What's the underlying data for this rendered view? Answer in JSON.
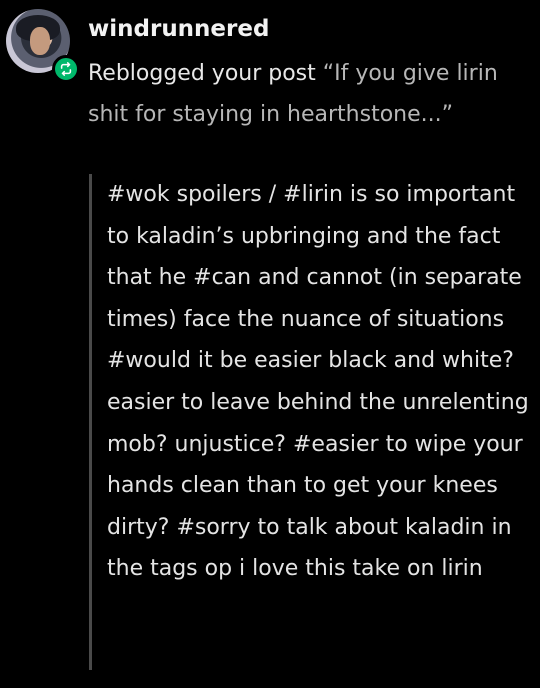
{
  "user": {
    "avatar_icon": "avatar",
    "badge_icon": "reblog-icon",
    "badge_color": "#00b86b",
    "username": "windrunnered"
  },
  "activity": {
    "action": "Reblogged your post",
    "post_ref": "“If you give lirin shit for staying in hearthstone...”"
  },
  "tags_text": "#wok spoilers / #lirin is so important to kaladin’s upbringing and the fact that he #can and cannot (in separate times) face the nuance of situations #would it be easier black and white? easier to leave behind the unrelenting mob? unjustice? #easier to wipe your hands clean than to get your knees dirty? #sorry to talk about kaladin in the tags op i love this take on lirin"
}
